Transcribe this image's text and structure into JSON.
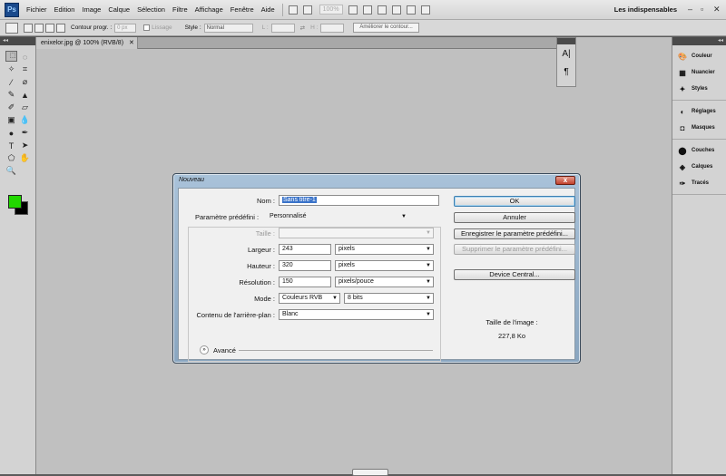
{
  "menubar": {
    "logo": "Ps",
    "items": [
      "Fichier",
      "Edition",
      "Image",
      "Calque",
      "Sélection",
      "Filtre",
      "Affichage",
      "Fenêtre",
      "Aide"
    ],
    "zoom": "100%",
    "workspace": "Les indispensables"
  },
  "options": {
    "contour_label": "Contour progr. :",
    "contour_value": "0 px",
    "lisser_label": "Lissage",
    "style_label": "Style :",
    "style_value": "Normal",
    "l_label": "L :",
    "h_label": "H :",
    "refine_button": "Améliorer le contour..."
  },
  "document": {
    "tab_label": "enixelor.jpg @ 100% (RVB/8)"
  },
  "right_panel": {
    "groups": [
      [
        {
          "label": "Couleur",
          "icon": "palette-icon"
        },
        {
          "label": "Nuancier",
          "icon": "swatches-icon"
        },
        {
          "label": "Styles",
          "icon": "styles-icon"
        }
      ],
      [
        {
          "label": "Réglages",
          "icon": "adjustments-icon"
        },
        {
          "label": "Masques",
          "icon": "masks-icon"
        }
      ],
      [
        {
          "label": "Couches",
          "icon": "channels-icon"
        },
        {
          "label": "Calques",
          "icon": "layers-icon"
        },
        {
          "label": "Tracés",
          "icon": "paths-icon"
        }
      ]
    ]
  },
  "dialog": {
    "title": "Nouveau",
    "name_label": "Nom :",
    "name_value": "Sans titre-1",
    "preset_label": "Paramètre prédéfini :",
    "preset_value": "Personnalisé",
    "size_label": "Taille :",
    "width_label": "Largeur :",
    "width_value": "243",
    "width_unit": "pixels",
    "height_label": "Hauteur :",
    "height_value": "320",
    "height_unit": "pixels",
    "resolution_label": "Résolution :",
    "resolution_value": "150",
    "resolution_unit": "pixels/pouce",
    "mode_label": "Mode :",
    "mode_value": "Couleurs RVB",
    "bits_value": "8 bits",
    "background_label": "Contenu de l'arrière-plan :",
    "background_value": "Blanc",
    "advanced_label": "Avancé",
    "buttons": {
      "ok": "OK",
      "cancel": "Annuler",
      "save_preset": "Enregistrer le paramètre prédéfini...",
      "delete_preset": "Supprimer le paramètre prédéfini...",
      "device_central": "Device Central..."
    },
    "image_size_label": "Taille de l'image :",
    "image_size_value": "227,8 Ko"
  },
  "colors": {
    "foreground": "#22d800",
    "background": "#000000"
  }
}
